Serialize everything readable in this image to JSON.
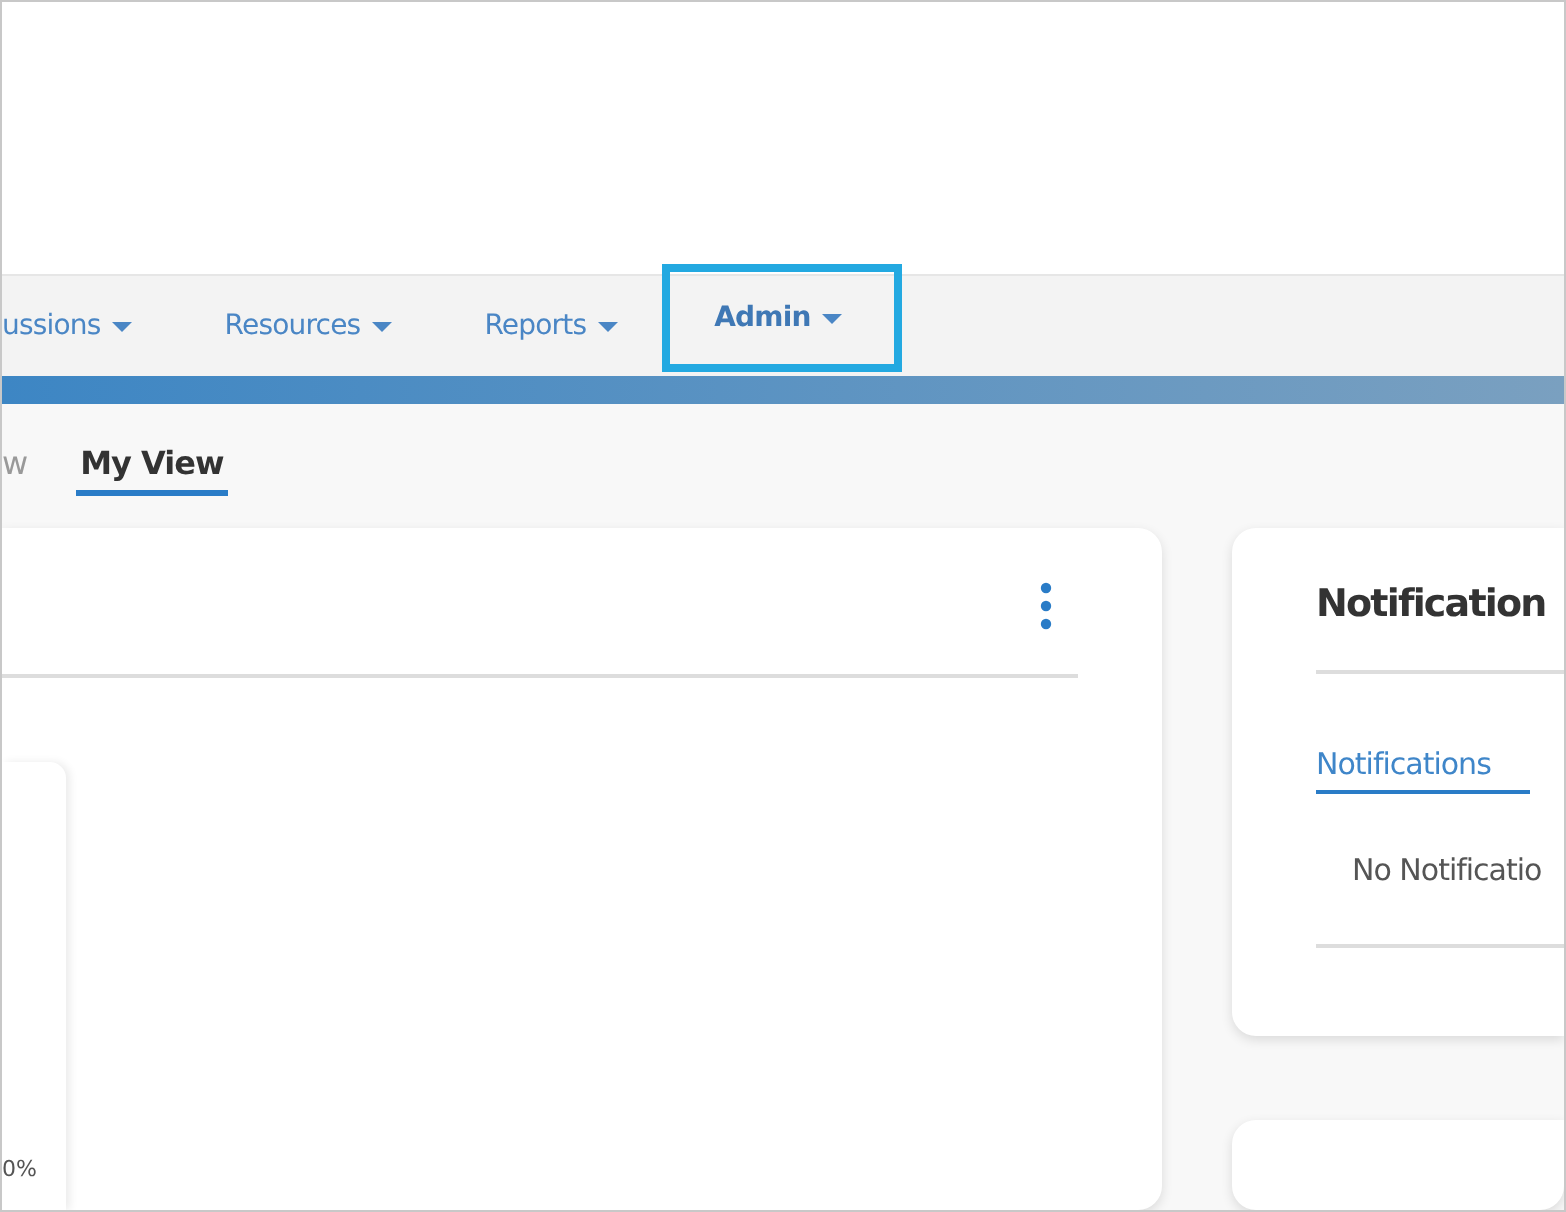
{
  "nav": {
    "items": [
      {
        "label": "ussions",
        "selected": false
      },
      {
        "label": "Resources",
        "selected": false
      },
      {
        "label": "Reports",
        "selected": false
      },
      {
        "label": "Admin",
        "selected": true
      }
    ]
  },
  "view_tabs": [
    {
      "label": "w",
      "selected": false
    },
    {
      "label": "My View",
      "selected": true
    }
  ],
  "main_card": {
    "axis_label": "0%"
  },
  "notifications_card": {
    "title": "Notification",
    "tabs": [
      {
        "label": "Notifications",
        "selected": true
      }
    ],
    "empty_message": "No Notificatio"
  }
}
